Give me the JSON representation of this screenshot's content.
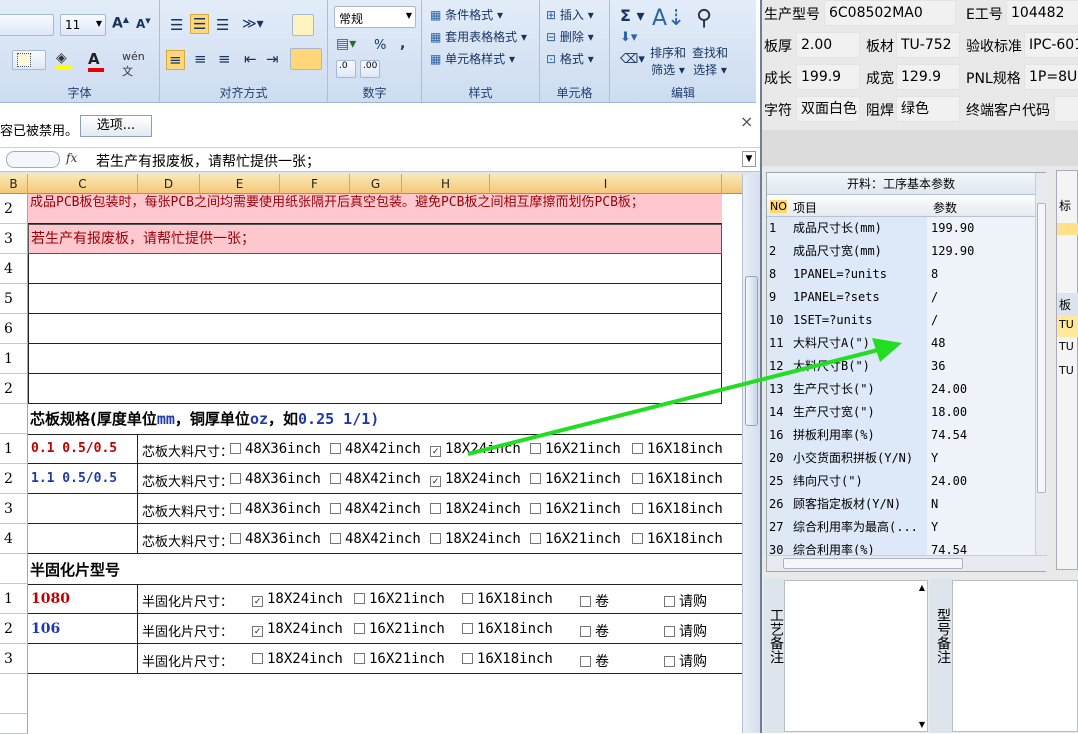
{
  "ribbon": {
    "font_group": "字体",
    "font_size": "11",
    "align_group": "对齐方式",
    "number_group": "数字",
    "number_format": "常规",
    "styles_group": "样式",
    "cond_format": "条件格式",
    "table_format": "套用表格格式",
    "cell_style": "单元格样式",
    "cells_group": "单元格",
    "insert": "插入",
    "delete": "删除",
    "format": "格式",
    "edit_group": "编辑",
    "sort_filter_a": "排序和",
    "sort_filter_b": "筛选",
    "find_select_a": "查找和",
    "find_select_b": "选择",
    "percent": "%",
    "comma": ","
  },
  "message_bar": {
    "text": "容已被禁用。",
    "options_button": "选项..."
  },
  "formula_bar": {
    "fx": "fx",
    "content": "若生产有报废板，请帮忙提供一张；"
  },
  "columns": [
    "B",
    "C",
    "D",
    "E",
    "F",
    "G",
    "H",
    "I"
  ],
  "rows": [
    {
      "num": "2",
      "text": "成品PCB板包装时，每张PCB之间均需要使用纸张隔开后真空包装。避免PCB板之间相互摩擦而划伤PCB板；"
    },
    {
      "num": "3",
      "text": "若生产有报废板，请帮忙提供一张；"
    },
    {
      "num": "4"
    },
    {
      "num": "5"
    },
    {
      "num": "6"
    },
    {
      "num": "1"
    },
    {
      "num": "2"
    }
  ],
  "core": {
    "heading_a": "芯板规格(厚度单位",
    "heading_unit1": "mm",
    "heading_b": "，铜厚单位",
    "heading_unit2": "oz",
    "heading_c": "，如",
    "heading_example": "0.25 1/1)",
    "label": "芯板大料尺寸：",
    "options": [
      "48X36inch",
      "48X42inch",
      "18X24inch",
      "16X21inch",
      "16X18inch"
    ],
    "rows": [
      {
        "num": "1",
        "spec": "0.1 0.5/0.5",
        "spec_color": "#c00000",
        "checked": [
          false,
          false,
          true,
          false,
          false
        ]
      },
      {
        "num": "2",
        "spec": "1.1 0.5/0.5",
        "spec_color": "#1f3aa8",
        "checked": [
          false,
          false,
          true,
          false,
          false
        ]
      },
      {
        "num": "3",
        "spec": "",
        "checked": [
          false,
          false,
          false,
          false,
          false
        ]
      },
      {
        "num": "4",
        "spec": "",
        "checked": [
          false,
          false,
          false,
          false,
          false
        ]
      }
    ]
  },
  "prepreg": {
    "heading": "半固化片型号",
    "label": "半固化片尺寸：",
    "options": [
      "18X24inch",
      "16X21inch",
      "16X18inch",
      "卷",
      "请购"
    ],
    "rows": [
      {
        "num": "1",
        "spec": "1080",
        "spec_color": "#c00000",
        "checked": [
          true,
          false,
          false,
          false,
          false
        ]
      },
      {
        "num": "2",
        "spec": "106",
        "spec_color": "#1f3aa8",
        "checked": [
          true,
          false,
          false,
          false,
          false
        ]
      },
      {
        "num": "3",
        "spec": "",
        "checked": [
          false,
          false,
          false,
          false,
          false
        ]
      }
    ]
  },
  "right": {
    "product_label": "生产型号",
    "product_value": "6C08502MA0",
    "eno_label": "E工号",
    "eno_value": "104482",
    "thickness_label": "板厚",
    "thickness_value": "2.00",
    "material_label": "板材",
    "material_value": "TU-752",
    "standard_label": "验收标准",
    "standard_value": "IPC-601",
    "length_label": "成长",
    "length_value": "199.9",
    "width_label": "成宽",
    "width_value": "129.9",
    "pnl_label": "PNL规格",
    "pnl_value": "1P=8U",
    "char_label": "字符",
    "char_value": "双面白色",
    "mask_label": "阻焊",
    "mask_value": "绿色",
    "customer_label": "终端客户代码",
    "customer_value": "",
    "grid_title": "开料：工序基本参数",
    "col_no": "NO",
    "col_item": "项目",
    "col_param": "参数",
    "grid": [
      {
        "no": "1",
        "item": "成品尺寸长(mm)",
        "val": "199.90"
      },
      {
        "no": "2",
        "item": "成品尺寸宽(mm)",
        "val": "129.90"
      },
      {
        "no": "8",
        "item": "1PANEL=?units",
        "val": "8"
      },
      {
        "no": "9",
        "item": "1PANEL=?sets",
        "val": "/"
      },
      {
        "no": "10",
        "item": "1SET=?units",
        "val": "/"
      },
      {
        "no": "11",
        "item": "大料尺寸A(\")",
        "val": "48"
      },
      {
        "no": "12",
        "item": "大料尺寸B(\")",
        "val": "36"
      },
      {
        "no": "13",
        "item": "生产尺寸长(\")",
        "val": "24.00"
      },
      {
        "no": "14",
        "item": "生产尺寸宽(\")",
        "val": "18.00"
      },
      {
        "no": "16",
        "item": "拼板利用率(%)",
        "val": "74.54"
      },
      {
        "no": "20",
        "item": "小交货面积拼板(Y/N)",
        "val": "Y"
      },
      {
        "no": "25",
        "item": "纬向尺寸(\")",
        "val": "24.00"
      },
      {
        "no": "26",
        "item": "顾客指定板材(Y/N)",
        "val": "N"
      },
      {
        "no": "27",
        "item": "综合利用率为最高(...",
        "val": "Y"
      },
      {
        "no": "30",
        "item": "综合利用率(%)",
        "val": "74.54"
      }
    ],
    "side_head": "标",
    "side_rows": [
      "板",
      "TU",
      "TU",
      "TU"
    ],
    "process_note": "工艺备注",
    "model_note": "型号备注"
  },
  "colors": {
    "highlight_row": "#ffc7ce",
    "highlight_text": "#9c0006",
    "arrow": "#22dd22",
    "selected_row": "#ffe89a"
  }
}
